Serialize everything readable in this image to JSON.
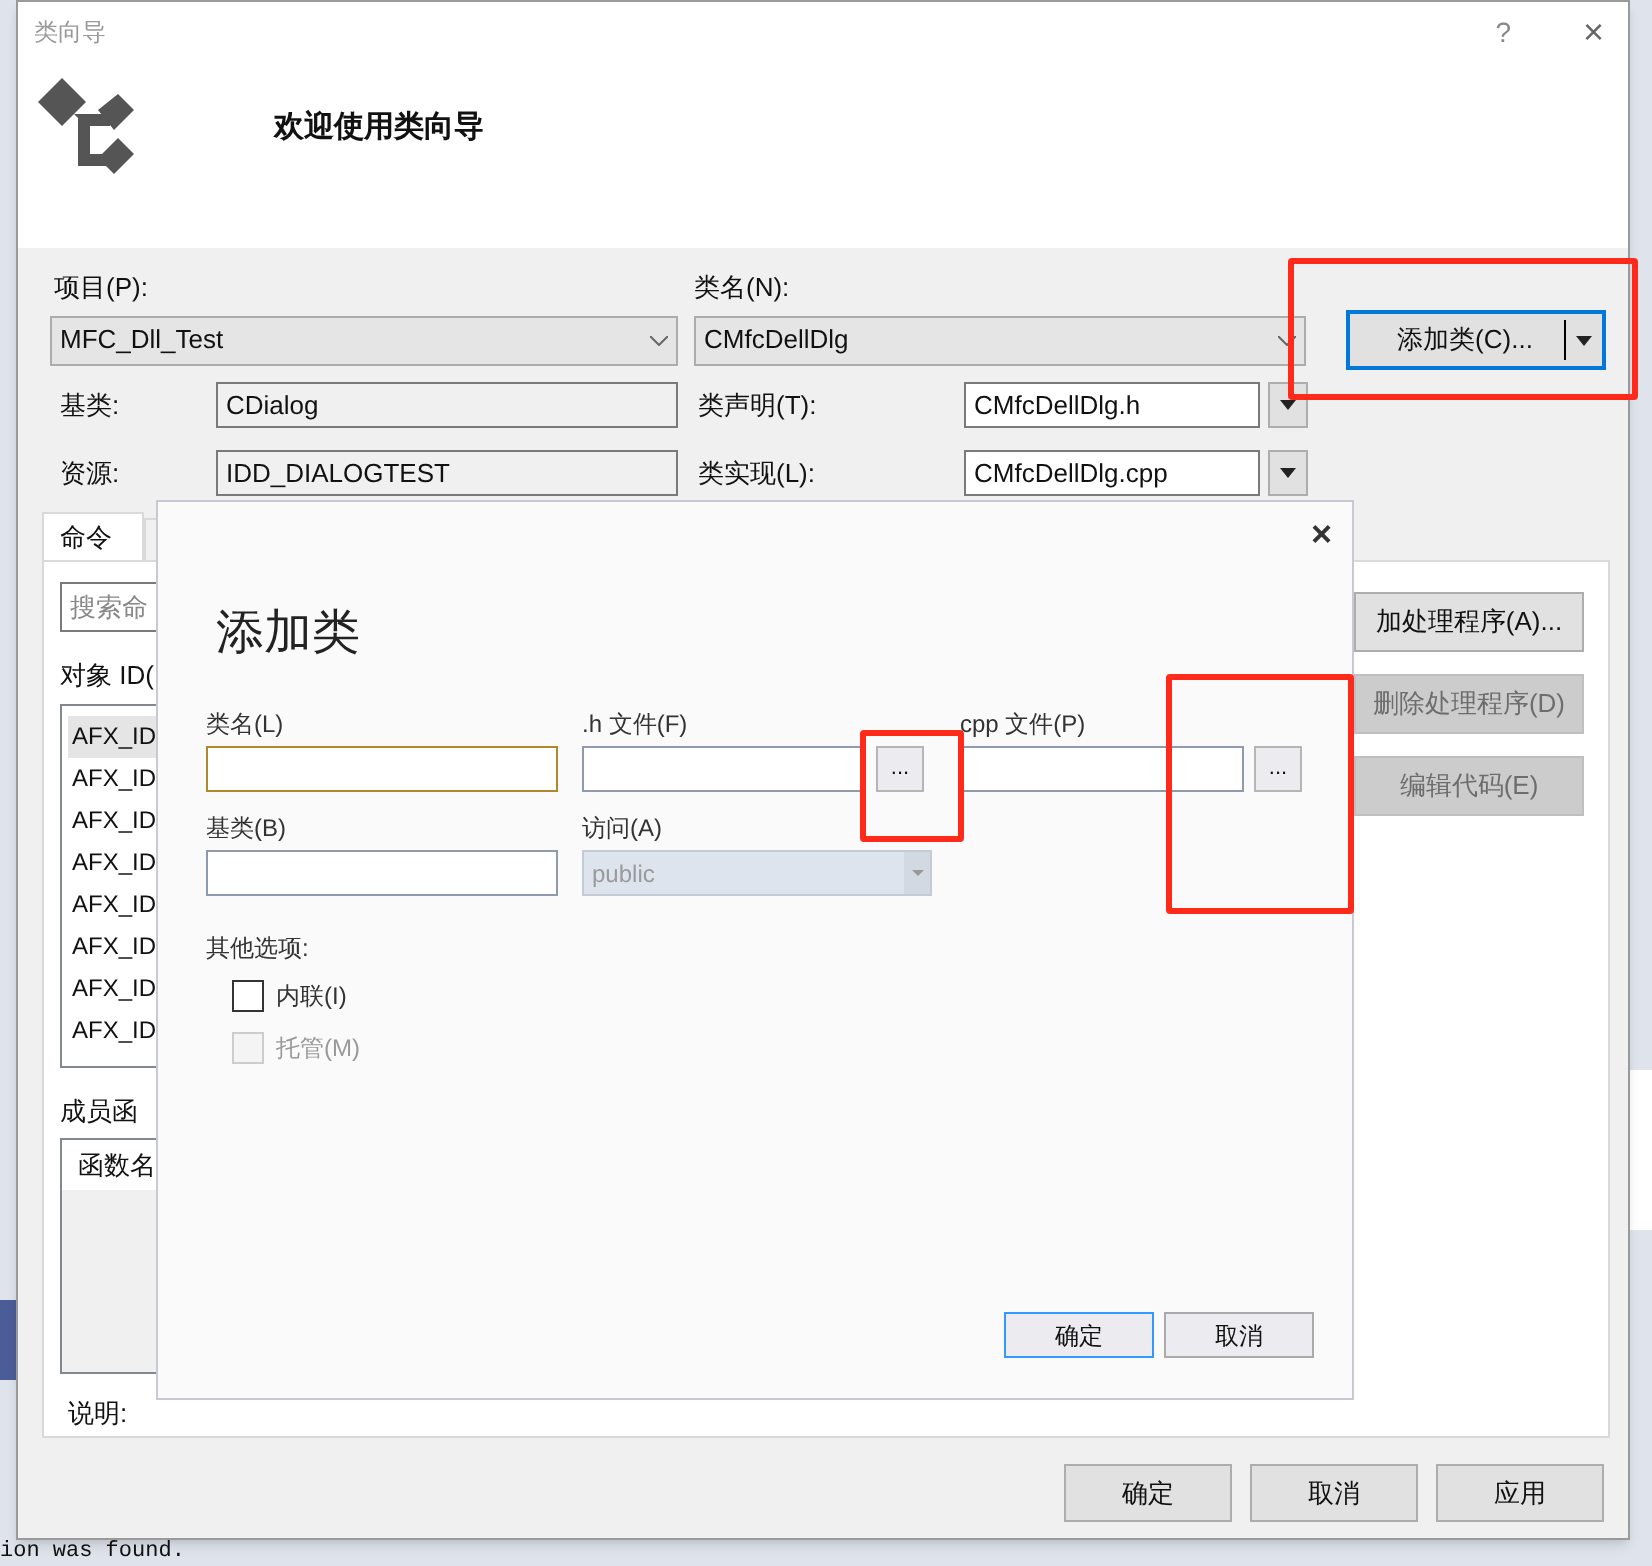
{
  "window": {
    "title": "类向导",
    "help": "?",
    "close": "×"
  },
  "header": {
    "heading": "欢迎使用类向导"
  },
  "project": {
    "label": "项目(P):",
    "value": "MFC_Dll_Test"
  },
  "class_name": {
    "label": "类名(N):",
    "value": "CMfcDellDlg"
  },
  "add_class_button": {
    "label": "添加类(C)..."
  },
  "base_class": {
    "label": "基类:",
    "value": "CDialog"
  },
  "resource": {
    "label": "资源:",
    "value": "IDD_DIALOGTEST"
  },
  "class_declaration": {
    "label": "类声明(T):",
    "value": "CMfcDellDlg.h"
  },
  "class_implementation": {
    "label": "类实现(L):",
    "value": "CMfcDellDlg.cpp"
  },
  "tabs": [
    {
      "label": "命令",
      "selected": true
    },
    {
      "selected": false
    }
  ],
  "commands": {
    "search_placeholder": "搜索命",
    "object_ids_label": "对象 ID(",
    "object_ids": [
      {
        "label": "AFX_ID",
        "selected": true
      },
      {
        "label": "AFX_ID",
        "selected": false
      },
      {
        "label": "AFX_ID",
        "selected": false
      },
      {
        "label": "AFX_ID",
        "selected": false
      },
      {
        "label": "AFX_ID",
        "selected": false
      },
      {
        "label": "AFX_ID",
        "selected": false
      },
      {
        "label": "AFX_ID",
        "selected": false
      },
      {
        "label": "AFX_ID",
        "selected": false
      }
    ],
    "member_functions_label": "成员函",
    "function_column": "函数名",
    "description_label": "说明:",
    "buttons": [
      {
        "label": "加处理程序(A)...",
        "disabled": false
      },
      {
        "label": "删除处理程序(D)",
        "disabled": true
      },
      {
        "label": "编辑代码(E)",
        "disabled": true
      }
    ]
  },
  "footer_buttons": [
    "确定",
    "取消",
    "应用"
  ],
  "add_class_dialog": {
    "close": "×",
    "title": "添加类",
    "fields": [
      {
        "kind": "text",
        "label": "类名(L)",
        "focused": true
      },
      {
        "kind": "file",
        "label": ".h 文件(F)",
        "browse": "...",
        "focused": false
      },
      {
        "kind": "file",
        "label": "cpp 文件(P)",
        "browse": "...",
        "focused": false
      },
      {
        "kind": "text",
        "label": "基类(B)",
        "focused": false
      },
      {
        "kind": "select",
        "label": "访问(A)",
        "value": "public",
        "disabled": true
      }
    ],
    "options_label": "其他选项:",
    "options": [
      {
        "label": "内联(I)",
        "checked": false,
        "disabled": false
      },
      {
        "label": "托管(M)",
        "checked": false,
        "disabled": true
      }
    ],
    "buttons": [
      {
        "label": "确定",
        "default": true
      },
      {
        "label": "取消",
        "default": false
      }
    ]
  },
  "background_text": [
    {
      "kind": "bottom",
      "text": "ion was found."
    }
  ]
}
